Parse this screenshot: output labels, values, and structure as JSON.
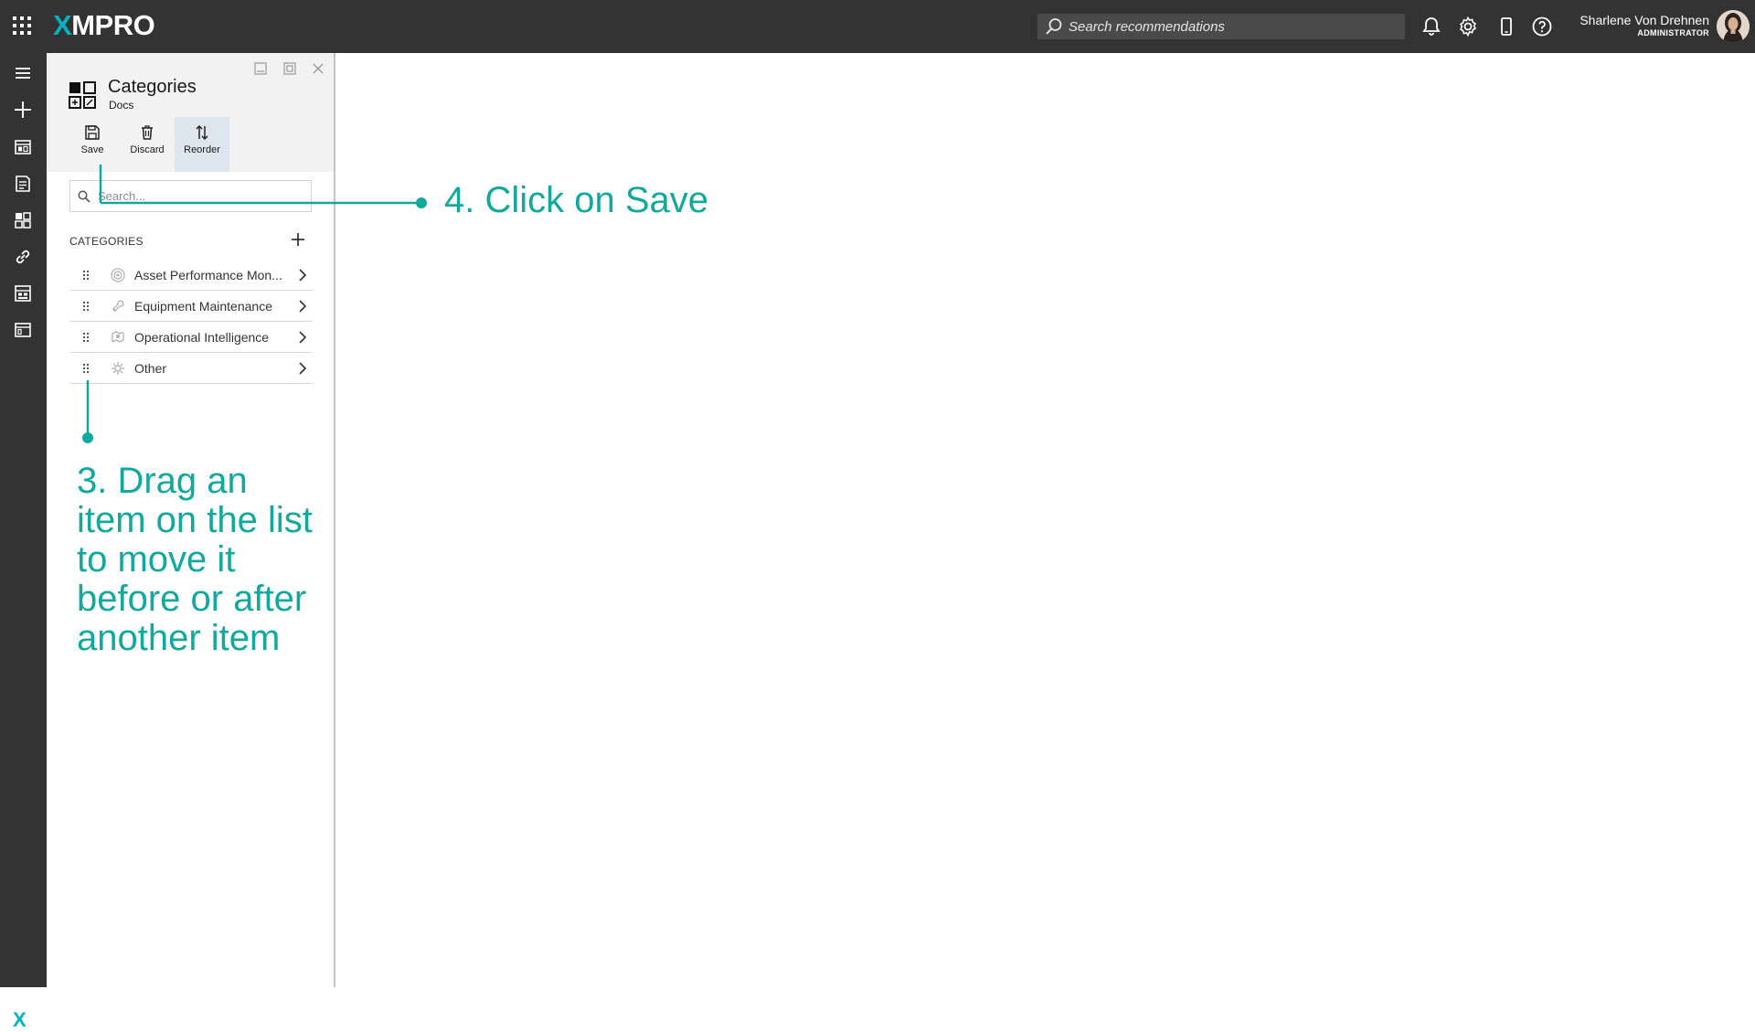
{
  "app": {
    "logo": "XMPRO",
    "search_placeholder": "Search recommendations",
    "user_name": "Sharlene Von Drehnen",
    "user_role": "ADMINISTRATOR"
  },
  "panel": {
    "title": "Categories",
    "subtitle": "Docs",
    "toolbar": {
      "save": "Save",
      "discard": "Discard",
      "reorder": "Reorder"
    },
    "search_placeholder": "Search...",
    "section_label": "CATEGORIES",
    "items": [
      {
        "label": "Asset Performance Mon...",
        "icon": "apm-category-icon"
      },
      {
        "label": "Equipment Maintenance",
        "icon": "maintenance-category-icon"
      },
      {
        "label": "Operational Intelligence",
        "icon": "intelligence-category-icon"
      },
      {
        "label": "Other",
        "icon": "other-category-icon"
      }
    ]
  },
  "annotations": {
    "step4": "4. Click on Save",
    "step3": "3. Drag an item on the list to move it before or after another item"
  },
  "colors": {
    "topbar": "#333333",
    "accent": "#00b3c0",
    "annotation": "#13a89e",
    "panel_header": "#f2f2f2",
    "active_tool": "#dde6ee"
  }
}
